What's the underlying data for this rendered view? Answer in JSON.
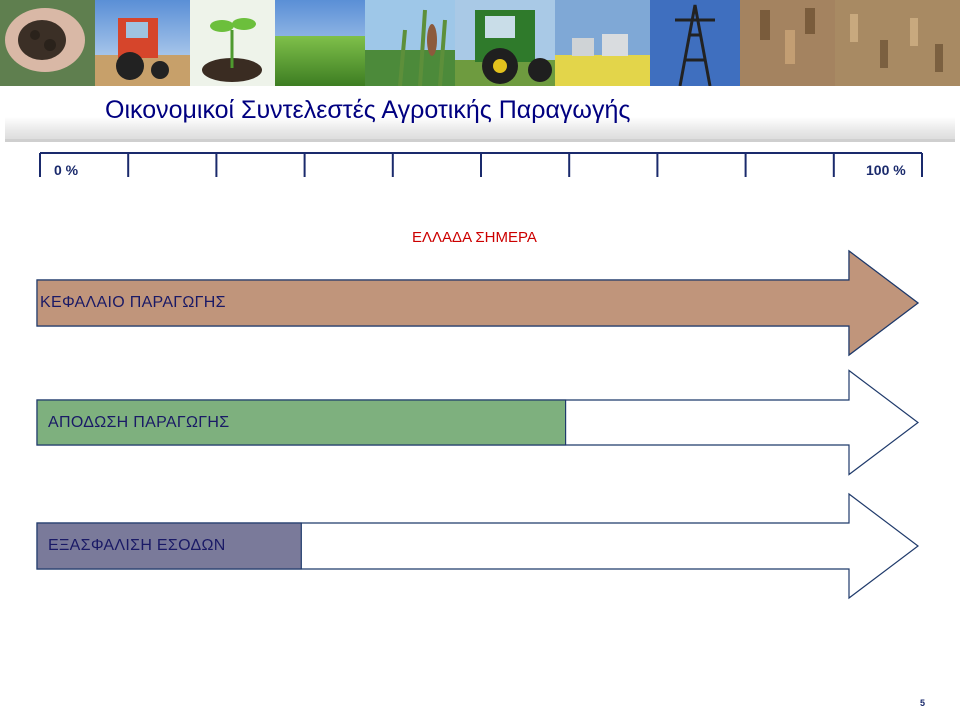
{
  "slide": {
    "title": "Οικονομικοί Συντελεστές Αγροτικής Παραγωγής",
    "page_number": "5"
  },
  "banner": {
    "panels": [
      "soil-hands-photo",
      "tractor-photo",
      "seedling-photo",
      "crop-field-photo",
      "corn-photo",
      "green-tractor-photo",
      "biogas-plant-photo",
      "power-pylon-photo",
      "pellets-photo"
    ]
  },
  "chart_data": {
    "type": "bar",
    "title": "ΕΛΛΑΔΑ ΣΗΜΕΡΑ",
    "scale_min_label": "0 %",
    "scale_max_label": "100 %",
    "xlim": [
      0,
      100
    ],
    "tick_count": 10,
    "categories": [
      "ΚΕΦΑΛΑΙΟ ΠΑΡΑΓΩΓΗΣ",
      "ΑΠΟΔΩΣΗ ΠΑΡΑΓΩΓΗΣ",
      "ΕΞΑΣΦΑΛΙΣΗ ΕΣΟΔΩΝ"
    ],
    "values": [
      100,
      60,
      30
    ],
    "colors": [
      "#c0957b",
      "#7eb07e",
      "#7a7a9a"
    ]
  }
}
